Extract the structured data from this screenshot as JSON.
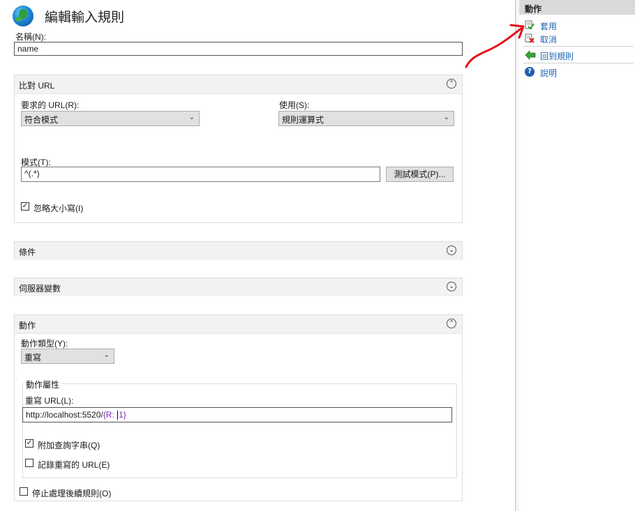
{
  "header": {
    "title": "編輯輸入規則",
    "icon": "globe-icon"
  },
  "name_field": {
    "label": "名稱(N):",
    "value": "name"
  },
  "match_url": {
    "title": "比對 URL",
    "requested_url": {
      "label": "要求的 URL(R):",
      "value": "符合模式"
    },
    "using": {
      "label": "使用(S):",
      "value": "規則運算式"
    },
    "pattern": {
      "label": "模式(T):",
      "value": "^(.*)"
    },
    "test_button": "測試模式(P)...",
    "ignore_case": {
      "label": "忽略大小寫(I)",
      "checked": true
    }
  },
  "conditions": {
    "title": "條件"
  },
  "server_variables": {
    "title": "伺服器變數"
  },
  "action": {
    "title": "動作",
    "type": {
      "label": "動作類型(Y):",
      "value": "重寫"
    },
    "properties": {
      "legend": "動作屬性",
      "rewrite_url_label": "重寫 URL(L):",
      "rewrite_url_prefix": "http://localhost:5520/",
      "rewrite_url_var": "{R:",
      "rewrite_url_tail": "1}",
      "append_query": {
        "label": "附加查詢字串(Q)",
        "checked": true
      },
      "log_rewritten": {
        "label": "記錄重寫的 URL(E)",
        "checked": false
      }
    },
    "stop_processing": {
      "label": "停止處理後續規則(O)",
      "checked": false
    }
  },
  "actions_pane": {
    "title": "動作",
    "items": [
      {
        "label": "套用",
        "icon": "apply-icon"
      },
      {
        "label": "取消",
        "icon": "cancel-icon"
      },
      {
        "label": "回到規則",
        "icon": "back-arrow-icon"
      },
      {
        "label": "說明",
        "icon": "help-icon"
      }
    ]
  },
  "colors": {
    "link": "#1e64b4",
    "annotation_arrow": "#e0101a",
    "section_header": "#f2f2f2"
  },
  "glyphs": {
    "check": "✓",
    "chevron_down": "⌄",
    "collapse": "⌃",
    "expand": "⌄",
    "help": "?"
  }
}
